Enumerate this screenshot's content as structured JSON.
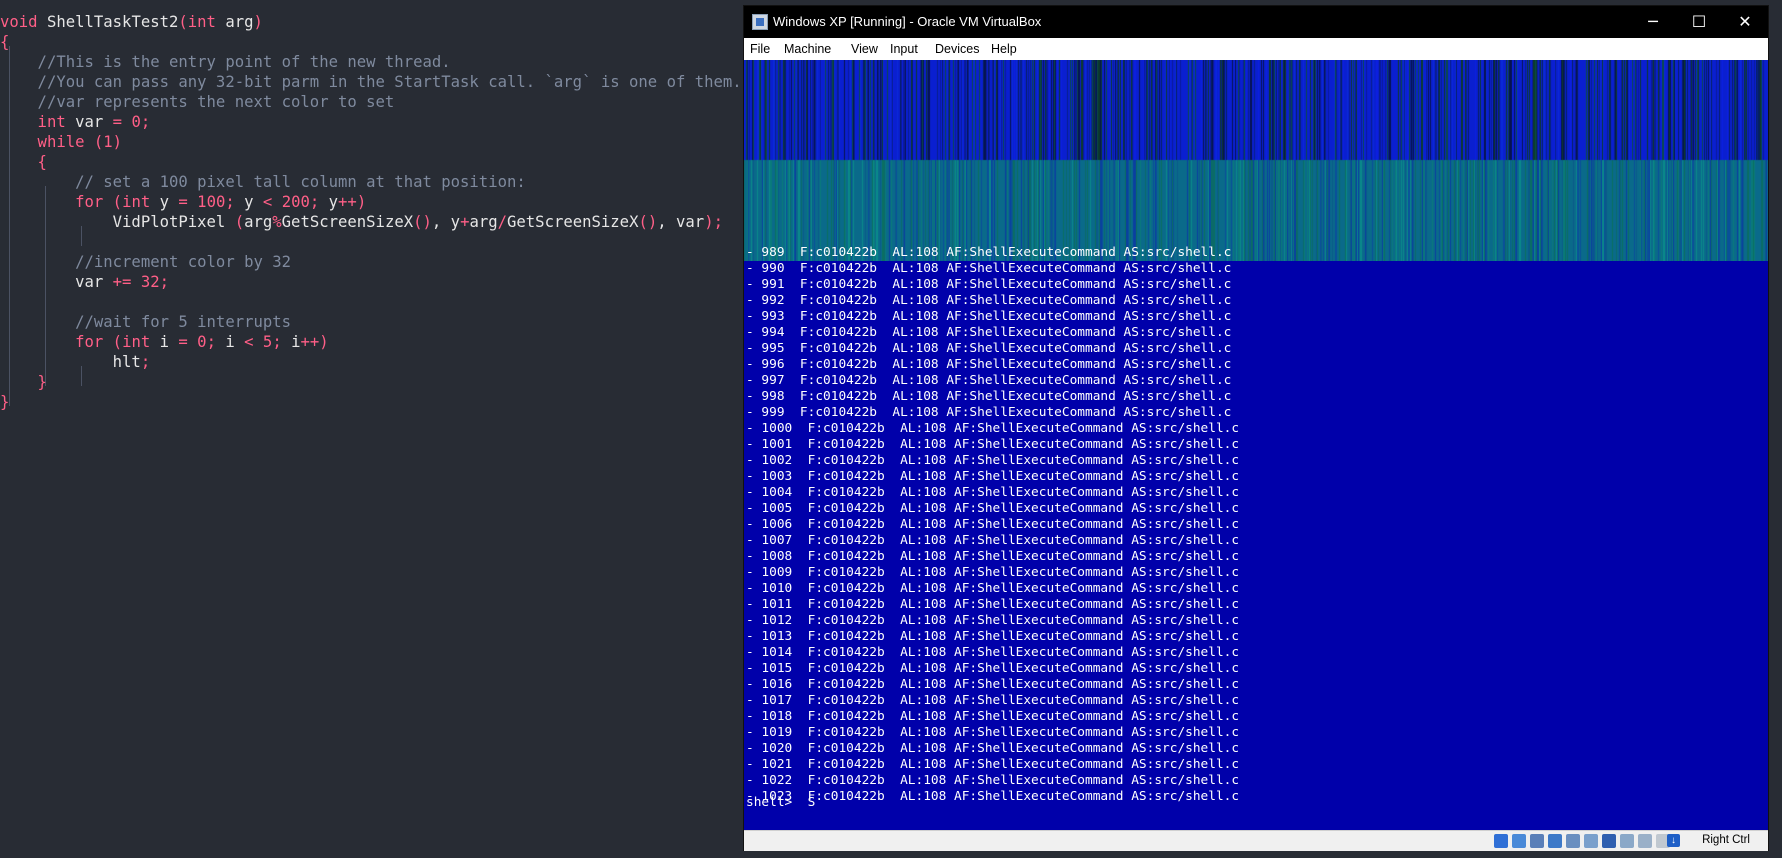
{
  "editor": {
    "lines": [
      [
        [
          "kw",
          "void"
        ],
        [
          "id",
          " ShellTaskTest2"
        ],
        [
          "brk",
          "("
        ],
        [
          "type",
          "int"
        ],
        [
          "id",
          " arg"
        ],
        [
          "brk",
          ")"
        ]
      ],
      [
        [
          "brk",
          "{"
        ]
      ],
      [
        [
          "cmt",
          "    //This is the entry point of the new thread."
        ]
      ],
      [
        [
          "cmt",
          "    //You can pass any 32-bit parm in the StartTask call. `arg` is one of them."
        ]
      ],
      [
        [
          "cmt",
          "    //var represents the next color to set"
        ]
      ],
      [
        [
          "type",
          "    int"
        ],
        [
          "id",
          " var "
        ],
        [
          "op",
          "="
        ],
        [
          "num",
          " 0"
        ],
        [
          "op",
          ";"
        ]
      ],
      [
        [
          "kw",
          "    while"
        ],
        [
          "id",
          " "
        ],
        [
          "brk",
          "("
        ],
        [
          "num",
          "1"
        ],
        [
          "brk",
          ")"
        ]
      ],
      [
        [
          "brk",
          "    {"
        ]
      ],
      [
        [
          "cmt",
          "        // set a 100 pixel tall column at that position:"
        ]
      ],
      [
        [
          "kw",
          "        for"
        ],
        [
          "id",
          " "
        ],
        [
          "brk",
          "("
        ],
        [
          "type",
          "int"
        ],
        [
          "id",
          " y "
        ],
        [
          "op",
          "="
        ],
        [
          "num",
          " 100"
        ],
        [
          "op",
          ";"
        ],
        [
          "id",
          " y "
        ],
        [
          "op",
          "<"
        ],
        [
          "num",
          " 200"
        ],
        [
          "op",
          ";"
        ],
        [
          "id",
          " y"
        ],
        [
          "op",
          "++"
        ],
        [
          "brk",
          ")"
        ]
      ],
      [
        [
          "id",
          "            VidPlotPixel "
        ],
        [
          "brk",
          "("
        ],
        [
          "id",
          "arg"
        ],
        [
          "op",
          "%"
        ],
        [
          "id",
          "GetScreenSizeX"
        ],
        [
          "brk",
          "()"
        ],
        [
          "id",
          ", y"
        ],
        [
          "op",
          "+"
        ],
        [
          "id",
          "arg"
        ],
        [
          "op",
          "/"
        ],
        [
          "id",
          "GetScreenSizeX"
        ],
        [
          "brk",
          "()"
        ],
        [
          "id",
          ", var"
        ],
        [
          "brk",
          ")"
        ],
        [
          "op",
          ";"
        ]
      ],
      [
        [
          "id",
          ""
        ]
      ],
      [
        [
          "cmt",
          "        //increment color by 32"
        ]
      ],
      [
        [
          "id",
          "        var "
        ],
        [
          "op",
          "+="
        ],
        [
          "num",
          " 32"
        ],
        [
          "op",
          ";"
        ]
      ],
      [
        [
          "id",
          ""
        ]
      ],
      [
        [
          "cmt",
          "        //wait for 5 interrupts"
        ]
      ],
      [
        [
          "kw",
          "        for"
        ],
        [
          "id",
          " "
        ],
        [
          "brk",
          "("
        ],
        [
          "type",
          "int"
        ],
        [
          "id",
          " i "
        ],
        [
          "op",
          "="
        ],
        [
          "num",
          " 0"
        ],
        [
          "op",
          ";"
        ],
        [
          "id",
          " i "
        ],
        [
          "op",
          "<"
        ],
        [
          "num",
          " 5"
        ],
        [
          "op",
          ";"
        ],
        [
          "id",
          " i"
        ],
        [
          "op",
          "++"
        ],
        [
          "brk",
          ")"
        ]
      ],
      [
        [
          "id",
          "            hlt"
        ],
        [
          "op",
          ";"
        ]
      ],
      [
        [
          "brk",
          "    }"
        ]
      ],
      [
        [
          "brk",
          "}"
        ]
      ]
    ]
  },
  "vbox": {
    "title": "Windows XP [Running] - Oracle VM VirtualBox",
    "menu": [
      "File",
      "Machine",
      "View",
      "Input",
      "Devices",
      "Help"
    ],
    "window_buttons": {
      "minimize": "─",
      "maximize": "☐",
      "close": "✕"
    },
    "host_key": "Right Ctrl",
    "colors": {
      "guest_bg": "#0000aa",
      "stripe_top": "#0a1fd0",
      "stripe_bottom": "#0a6a8a"
    }
  },
  "console": {
    "partial_line": "- 989  F:c010422b  AL:108 AF:ShellExecuteCommand AS:src/shell.c",
    "lines": [
      "- 990  F:c010422b  AL:108 AF:ShellExecuteCommand AS:src/shell.c",
      "- 991  F:c010422b  AL:108 AF:ShellExecuteCommand AS:src/shell.c",
      "- 992  F:c010422b  AL:108 AF:ShellExecuteCommand AS:src/shell.c",
      "- 993  F:c010422b  AL:108 AF:ShellExecuteCommand AS:src/shell.c",
      "- 994  F:c010422b  AL:108 AF:ShellExecuteCommand AS:src/shell.c",
      "- 995  F:c010422b  AL:108 AF:ShellExecuteCommand AS:src/shell.c",
      "- 996  F:c010422b  AL:108 AF:ShellExecuteCommand AS:src/shell.c",
      "- 997  F:c010422b  AL:108 AF:ShellExecuteCommand AS:src/shell.c",
      "- 998  F:c010422b  AL:108 AF:ShellExecuteCommand AS:src/shell.c",
      "- 999  F:c010422b  AL:108 AF:ShellExecuteCommand AS:src/shell.c",
      "- 1000  F:c010422b  AL:108 AF:ShellExecuteCommand AS:src/shell.c",
      "- 1001  F:c010422b  AL:108 AF:ShellExecuteCommand AS:src/shell.c",
      "- 1002  F:c010422b  AL:108 AF:ShellExecuteCommand AS:src/shell.c",
      "- 1003  F:c010422b  AL:108 AF:ShellExecuteCommand AS:src/shell.c",
      "- 1004  F:c010422b  AL:108 AF:ShellExecuteCommand AS:src/shell.c",
      "- 1005  F:c010422b  AL:108 AF:ShellExecuteCommand AS:src/shell.c",
      "- 1006  F:c010422b  AL:108 AF:ShellExecuteCommand AS:src/shell.c",
      "- 1007  F:c010422b  AL:108 AF:ShellExecuteCommand AS:src/shell.c",
      "- 1008  F:c010422b  AL:108 AF:ShellExecuteCommand AS:src/shell.c",
      "- 1009  F:c010422b  AL:108 AF:ShellExecuteCommand AS:src/shell.c",
      "- 1010  F:c010422b  AL:108 AF:ShellExecuteCommand AS:src/shell.c",
      "- 1011  F:c010422b  AL:108 AF:ShellExecuteCommand AS:src/shell.c",
      "- 1012  F:c010422b  AL:108 AF:ShellExecuteCommand AS:src/shell.c",
      "- 1013  F:c010422b  AL:108 AF:ShellExecuteCommand AS:src/shell.c",
      "- 1014  F:c010422b  AL:108 AF:ShellExecuteCommand AS:src/shell.c",
      "- 1015  F:c010422b  AL:108 AF:ShellExecuteCommand AS:src/shell.c",
      "- 1016  F:c010422b  AL:108 AF:ShellExecuteCommand AS:src/shell.c",
      "- 1017  F:c010422b  AL:108 AF:ShellExecuteCommand AS:src/shell.c",
      "- 1018  F:c010422b  AL:108 AF:ShellExecuteCommand AS:src/shell.c",
      "- 1019  F:c010422b  AL:108 AF:ShellExecuteCommand AS:src/shell.c",
      "- 1020  F:c010422b  AL:108 AF:ShellExecuteCommand AS:src/shell.c",
      "- 1021  F:c010422b  AL:108 AF:ShellExecuteCommand AS:src/shell.c",
      "- 1022  F:c010422b  AL:108 AF:ShellExecuteCommand AS:src/shell.c",
      "- 1023  F:c010422b  AL:108 AF:ShellExecuteCommand AS:src/shell.c"
    ],
    "prompt": "shell>  S"
  },
  "statusbar": {
    "icons": [
      "hard-disk-icon",
      "optical-drive-icon",
      "audio-icon",
      "network-icon",
      "usb-icon",
      "shared-folders-icon",
      "display-icon",
      "video-capture-icon",
      "cpu-icon",
      "mouse-integration-icon"
    ]
  }
}
